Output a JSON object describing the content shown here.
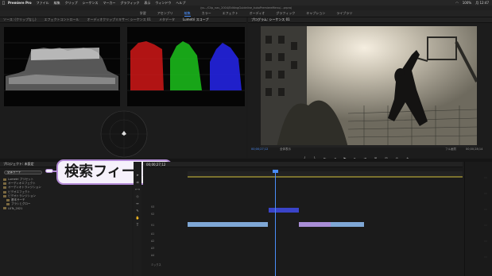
{
  "menubar": {
    "app_name": "Premiere Pro",
    "items": [
      "ファイル",
      "編集",
      "クリップ",
      "シーケンス",
      "マーカー",
      "グラフィック",
      "表示",
      "ウィンドウ",
      "ヘルプ"
    ],
    "battery": "100%",
    "clock": "月 12:47"
  },
  "titlebar": {
    "text": "/ys.../Clip_nav_2004/EditingGuideline_kukoPremiereMenu/...prproj"
  },
  "workspaces": {
    "items": [
      "学習",
      "アセンブリ",
      "編集",
      "カラー",
      "エフェクト",
      "オーディオ",
      "グラフィック",
      "キャプション",
      "ライブラリ"
    ],
    "active_index": 2
  },
  "scopes_panel": {
    "tabs": [
      "ソース: (クリップなし)",
      "エフェクトコントロール",
      "オーディオクリップミキサー: シーケンス 01",
      "メタデータ",
      "Lumetri スコープ"
    ],
    "active_tab_index": 4
  },
  "monitor_panel": {
    "title": "プログラム: シーケンス 01",
    "timecode_left": "00;00;27;12",
    "fit": "全体表示",
    "quality": "フル画質",
    "timecode_right": "00;00;28;14"
  },
  "project_panel": {
    "title": "プロジェクト: 未設定",
    "search_value": "全体サーチ",
    "items": [
      "Lumetri プリセット",
      "オーディオエフェクト",
      "オーディオトランジション",
      "ビデオエフェクト",
      "ビデオトランジション",
      "基本サーチ",
      "ブラシとグロー",
      "LUTs_2021"
    ]
  },
  "callout": {
    "text": "検索フィールド"
  },
  "timeline": {
    "timecode": "00;00;27;12",
    "tracks": [
      {
        "label": "V3"
      },
      {
        "label": "V2"
      },
      {
        "label": "V1"
      },
      {
        "label": "A1"
      },
      {
        "label": "A2"
      },
      {
        "label": "A3"
      },
      {
        "label": "A4"
      },
      {
        "label": "ミックス"
      }
    ],
    "ruler_marks": [
      "00;00",
      "00;00;04;00",
      "00;00;08;00",
      "00;00;12;00",
      "00;00;16;00",
      "00;00;20;00",
      "00;00;24;00",
      "00;00;28;00",
      "00;00;32;00",
      "00;00;36;00"
    ]
  },
  "colors": {
    "accent": "#4a8df8",
    "clip_blue": "#3a44c9",
    "clip_audio": "#7fa8d6",
    "clip_purple": "#a98ed6",
    "callout_border": "#b38bd6"
  }
}
